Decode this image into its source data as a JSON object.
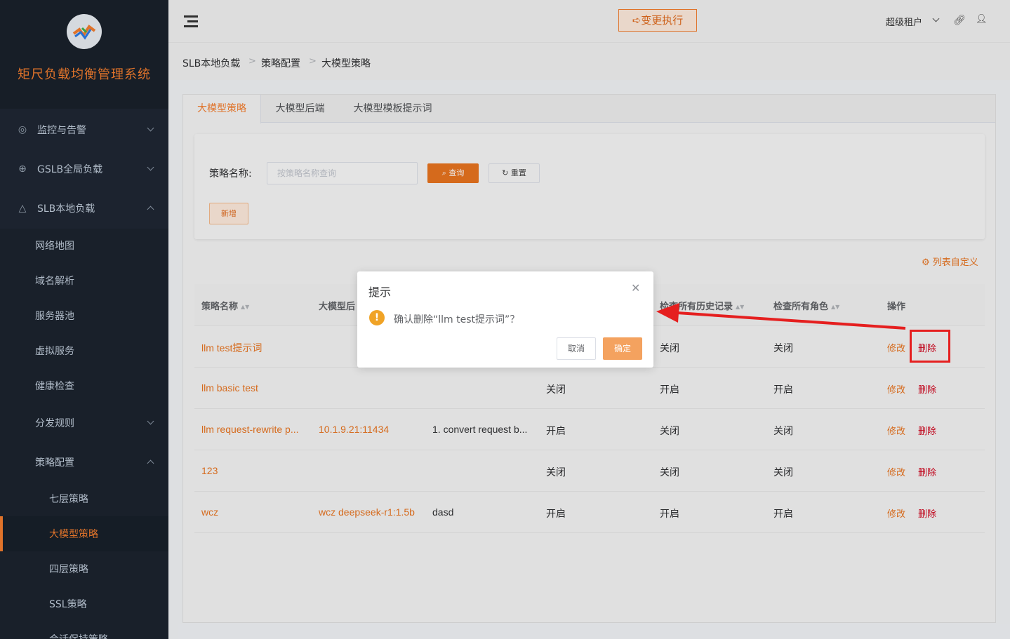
{
  "app": {
    "title": "矩尺负载均衡管理系统"
  },
  "sidebar": {
    "items": [
      {
        "label": "监控与告警",
        "icon": "monitor-icon"
      },
      {
        "label": "GSLB全局负载",
        "icon": "globe-icon"
      },
      {
        "label": "SLB本地负载",
        "icon": "cluster-icon"
      },
      {
        "label": "网络地图"
      },
      {
        "label": "域名解析"
      },
      {
        "label": "服务器池"
      },
      {
        "label": "虚拟服务"
      },
      {
        "label": "健康检查"
      },
      {
        "label": "分发规则"
      },
      {
        "label": "策略配置"
      },
      {
        "label": "七层策略"
      },
      {
        "label": "大模型策略"
      },
      {
        "label": "四层策略"
      },
      {
        "label": "SSL策略"
      },
      {
        "label": "会话保持策略"
      }
    ]
  },
  "header": {
    "change_button": "➪变更执行",
    "tenant": "超级租户"
  },
  "breadcrumb": [
    "SLB本地负载",
    "策略配置",
    "大模型策略"
  ],
  "tabs": [
    "大模型策略",
    "大模型后端",
    "大模型模板提示词"
  ],
  "search": {
    "label": "策略名称:",
    "placeholder": "按策略名称查询",
    "query_button": "查询",
    "reset_button": "重置",
    "add_button": "新增"
  },
  "table": {
    "customize_label": "列表自定义",
    "columns": [
      "策略名称",
      "大模型后",
      "检查所有历史记录",
      "检查所有角色",
      "操作"
    ],
    "rows": [
      {
        "name": "llm test提示词",
        "backend": "",
        "template": "",
        "c4": "",
        "history": "关闭",
        "roles": "关闭",
        "edit": "修改",
        "delete": "删除"
      },
      {
        "name": "llm basic test",
        "backend": "",
        "template": "",
        "c4": "关闭",
        "history": "开启",
        "roles": "开启",
        "edit": "修改",
        "delete": "删除"
      },
      {
        "name": "llm request-rewrite p...",
        "backend": "10.1.9.21:11434",
        "template": "1. convert request b...",
        "c4": "开启",
        "history": "关闭",
        "roles": "关闭",
        "edit": "修改",
        "delete": "删除"
      },
      {
        "name": "123",
        "backend": "",
        "template": "",
        "c4": "关闭",
        "history": "关闭",
        "roles": "关闭",
        "edit": "修改",
        "delete": "删除"
      },
      {
        "name": "wcz",
        "backend": "wcz deepseek-r1:1.5b",
        "template": "dasd",
        "c4": "开启",
        "history": "开启",
        "roles": "开启",
        "edit": "修改",
        "delete": "删除"
      }
    ]
  },
  "dialog": {
    "title": "提示",
    "message": "确认删除“llm test提示词”？",
    "cancel": "取消",
    "confirm": "确定"
  },
  "colors": {
    "accent": "#f27d2e",
    "danger": "#d0021b",
    "sidebar": "#1f2733"
  }
}
